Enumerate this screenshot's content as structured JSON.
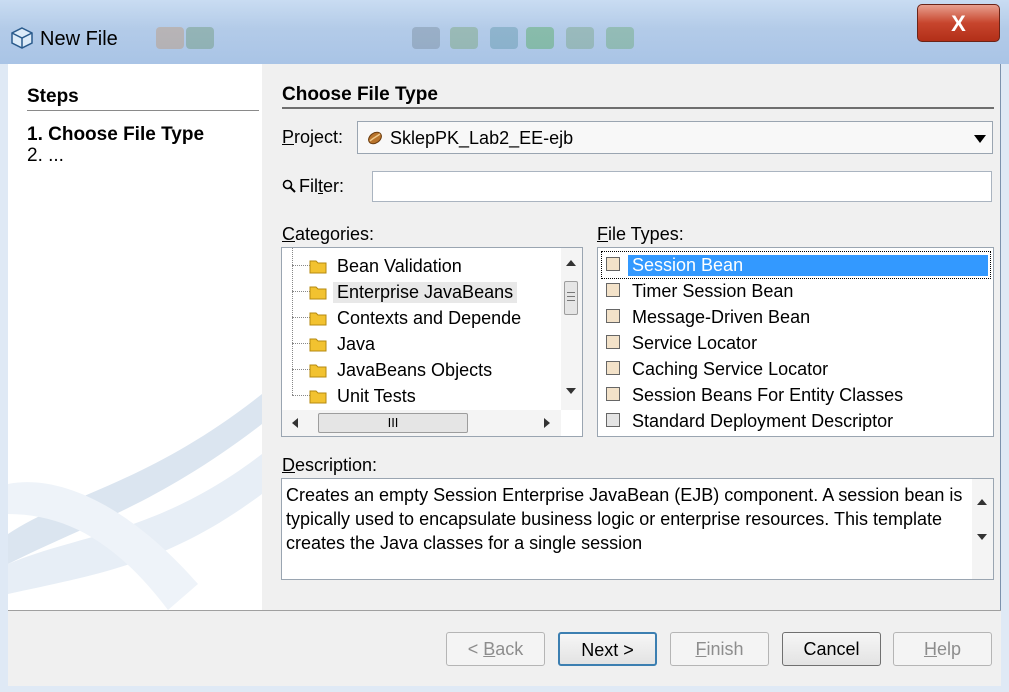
{
  "window": {
    "title": "New File",
    "close_label": "X"
  },
  "steps": {
    "heading": "Steps",
    "items": [
      "1.  Choose File Type",
      "2.  ..."
    ]
  },
  "main": {
    "heading": "Choose File Type"
  },
  "project": {
    "label_ul": "P",
    "label_rest": "roject:",
    "value": "SklepPK_Lab2_EE-ejb"
  },
  "filter": {
    "label_pre": "Fil",
    "label_ul": "t",
    "label_post": "er:",
    "value": ""
  },
  "categories": {
    "label_ul": "C",
    "label_rest": "ategories:",
    "items": [
      "Bean Validation",
      "Enterprise JavaBeans",
      "Contexts and Depende",
      "Java",
      "JavaBeans Objects",
      "Unit Tests"
    ],
    "selected_index": 1
  },
  "file_types": {
    "label_ul": "F",
    "label_rest": "ile Types:",
    "items": [
      "Session Bean",
      "Timer Session Bean",
      "Message-Driven Bean",
      "Service Locator",
      "Caching Service Locator",
      "Session Beans For Entity Classes",
      "Standard Deployment Descriptor"
    ],
    "selected_index": 0
  },
  "description": {
    "label_ul": "D",
    "label_rest": "escription:",
    "text": "Creates an empty Session Enterprise JavaBean (EJB) component. A session bean is typically used to encapsulate business logic or enterprise resources. This template creates the Java classes for a single session"
  },
  "buttons": {
    "back": {
      "pre": "< ",
      "ul": "B",
      "post": "ack"
    },
    "next": "Next >",
    "finish": {
      "ul": "F",
      "post": "inish"
    },
    "cancel": "Cancel",
    "help": {
      "ul": "H",
      "post": "elp"
    }
  },
  "hscroll_grip": "III",
  "colors": {
    "selection": "#3399ff",
    "titlebar": "#b3cbe8",
    "close": "#c7452d"
  }
}
